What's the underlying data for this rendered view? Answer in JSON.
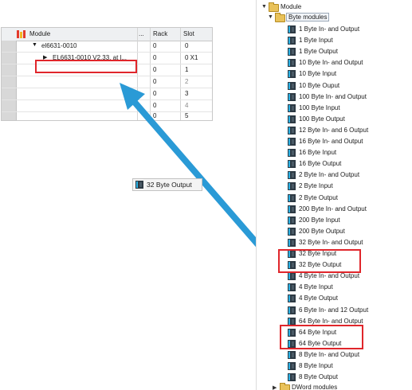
{
  "device_table": {
    "columns": {
      "module": "Module",
      "dots": "...",
      "rack": "Rack",
      "slot": "Slot"
    },
    "rows": [
      {
        "module": "el6631-0010",
        "rack": "0",
        "slot": "0",
        "slot_dim": false
      },
      {
        "module": "EL6631-0010 V2.33, at l...",
        "rack": "0",
        "slot": "0 X1",
        "slot_dim": false
      },
      {
        "module": "",
        "rack": "0",
        "slot": "1",
        "slot_dim": false
      },
      {
        "module": "",
        "rack": "0",
        "slot": "2",
        "slot_dim": true
      },
      {
        "module": "",
        "rack": "0",
        "slot": "3",
        "slot_dim": false
      },
      {
        "module": "",
        "rack": "0",
        "slot": "4",
        "slot_dim": true
      },
      {
        "module": "",
        "rack": "0",
        "slot": "5",
        "slot_dim": false
      }
    ]
  },
  "drag_ghost": {
    "label": "32 Byte Output"
  },
  "catalog": {
    "root": "Module",
    "folder": "Byte modules",
    "items": [
      "1 Byte In- and Output",
      "1 Byte Input",
      "1 Byte Output",
      "10 Byte In- and Output",
      "10 Byte Input",
      "10 Byte Ouput",
      "100 Byte In- and Output",
      "100 Byte Input",
      "100 Byte Output",
      "12 Byte In- and 6 Output",
      "16 Byte In- and Output",
      "16 Byte Input",
      "16 Byte Output",
      "2 Byte In- and Output",
      "2 Byte Input",
      "2 Byte Output",
      "200 Byte In- and Output",
      "200 Byte Input",
      "200 Byte Output",
      "32 Byte In- and Output",
      "32 Byte Input",
      "32 Byte Output",
      "4 Byte In- and Output",
      "4 Byte Input",
      "4 Byte Output",
      "6 Byte In- and 12 Output",
      "64 Byte In- and Output",
      "64 Byte Input",
      "64 Byte Output",
      "8 Byte In- and Output",
      "8 Byte Input",
      "8 Byte Output"
    ],
    "next_folder": "DWord modules"
  },
  "colors": {
    "highlight": "#e0262b",
    "arrow": "#2a9ad6",
    "folder": "#e9c25a"
  }
}
